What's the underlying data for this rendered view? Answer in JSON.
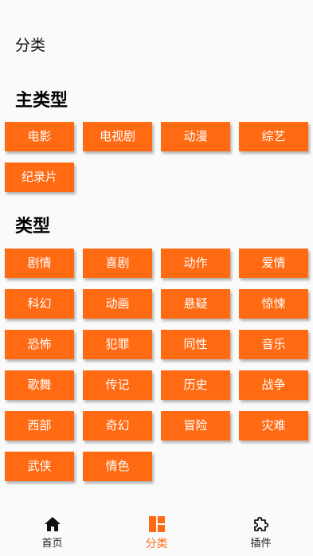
{
  "page": {
    "title": "分类"
  },
  "sections": {
    "main_types": {
      "heading": "主类型",
      "items": [
        "电影",
        "电视剧",
        "动漫",
        "综艺",
        "纪录片"
      ]
    },
    "types": {
      "heading": "类型",
      "items": [
        "剧情",
        "喜剧",
        "动作",
        "爱情",
        "科幻",
        "动画",
        "悬疑",
        "惊悚",
        "恐怖",
        "犯罪",
        "同性",
        "音乐",
        "歌舞",
        "传记",
        "历史",
        "战争",
        "西部",
        "奇幻",
        "冒险",
        "灾难",
        "武侠",
        "情色"
      ]
    }
  },
  "bottom_nav": {
    "items": [
      {
        "label": "首页",
        "icon": "home-icon",
        "active": false
      },
      {
        "label": "分类",
        "icon": "category-grid-icon",
        "active": true
      },
      {
        "label": "插件",
        "icon": "puzzle-icon",
        "active": false
      }
    ]
  },
  "colors": {
    "accent": "#ff6a13",
    "chip_text": "#ffffff",
    "background": "#fafafa"
  }
}
